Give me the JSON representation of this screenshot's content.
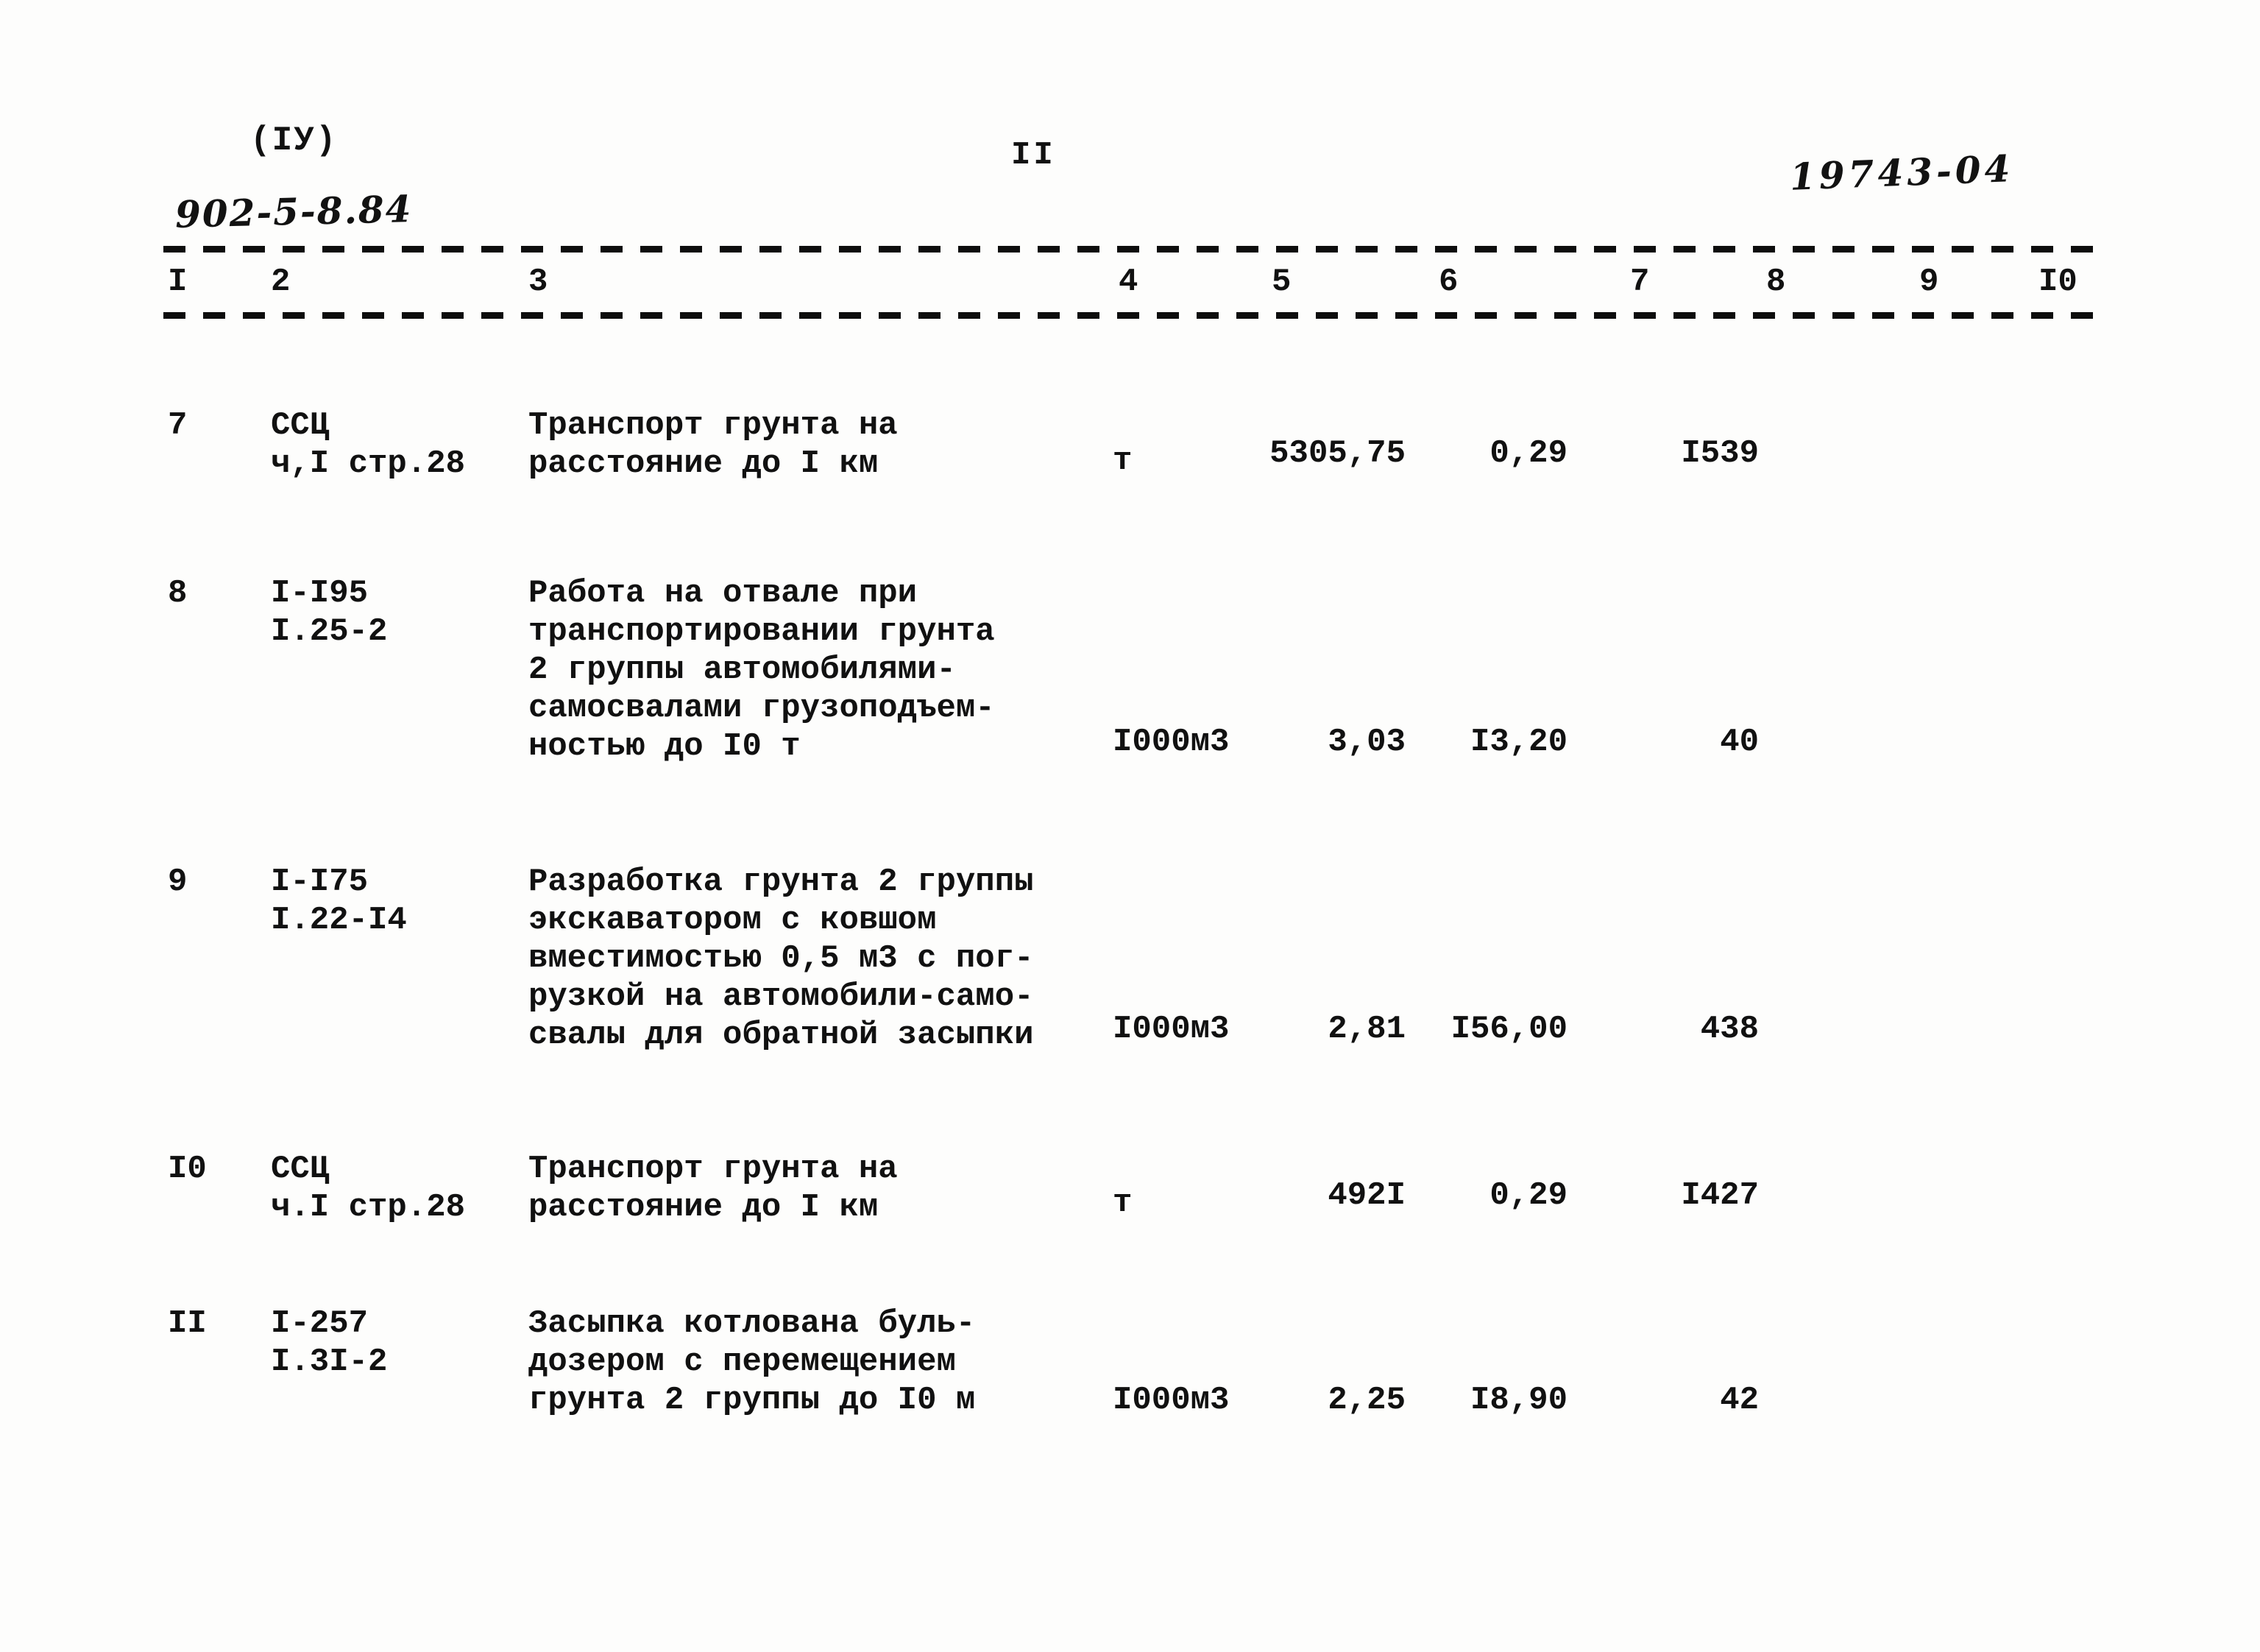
{
  "header": {
    "section_marker": "(IУ)",
    "page_number": "II",
    "doc_code_handwritten": "902-5-8.84",
    "stamp_handwritten": "19743-04"
  },
  "table": {
    "column_numbers": [
      "I",
      "2",
      "3",
      "4",
      "5",
      "6",
      "7",
      "8",
      "9",
      "I0"
    ],
    "rows": [
      {
        "num": "7",
        "code_line1": "ССЦ",
        "code_line2": "ч,I стр.28",
        "desc_line1": "Транспорт грунта на",
        "desc_line2": "расстояние до I км",
        "desc_line3": "",
        "desc_line4": "",
        "desc_line5": "",
        "unit": "т",
        "qty": "5305,75",
        "price": "0,29",
        "total": "I539"
      },
      {
        "num": "8",
        "code_line1": "I-I95",
        "code_line2": "I.25-2",
        "desc_line1": "Работа на отвале при",
        "desc_line2": "транспортировании грунта",
        "desc_line3": "2 группы автомобилями-",
        "desc_line4": "самосвалами грузоподъем-",
        "desc_line5": "ностью до I0 т",
        "unit": "I000м3",
        "qty": "3,03",
        "price": "I3,20",
        "total": "40"
      },
      {
        "num": "9",
        "code_line1": "I-I75",
        "code_line2": "I.22-I4",
        "desc_line1": "Разработка грунта 2 группы",
        "desc_line2": "экскаватором с ковшом",
        "desc_line3": "вместимостью 0,5 м3 с пог-",
        "desc_line4": "рузкой на автомобили-само-",
        "desc_line5": "свалы для обратной засыпки",
        "unit": "I000м3",
        "qty": "2,81",
        "price": "I56,00",
        "total": "438"
      },
      {
        "num": "I0",
        "code_line1": "ССЦ",
        "code_line2": "ч.I стр.28",
        "desc_line1": "Транспорт грунта на",
        "desc_line2": "расстояние до I км",
        "desc_line3": "",
        "desc_line4": "",
        "desc_line5": "",
        "unit": "т",
        "qty": "492I",
        "price": "0,29",
        "total": "I427"
      },
      {
        "num": "II",
        "code_line1": "I-257",
        "code_line2": "I.3I-2",
        "desc_line1": "Засыпка котлована буль-",
        "desc_line2": "дозером с перемещением",
        "desc_line3": "грунта 2 группы до I0 м",
        "desc_line4": "",
        "desc_line5": "",
        "unit": "I000м3",
        "qty": "2,25",
        "price": "I8,90",
        "total": "42"
      }
    ]
  }
}
